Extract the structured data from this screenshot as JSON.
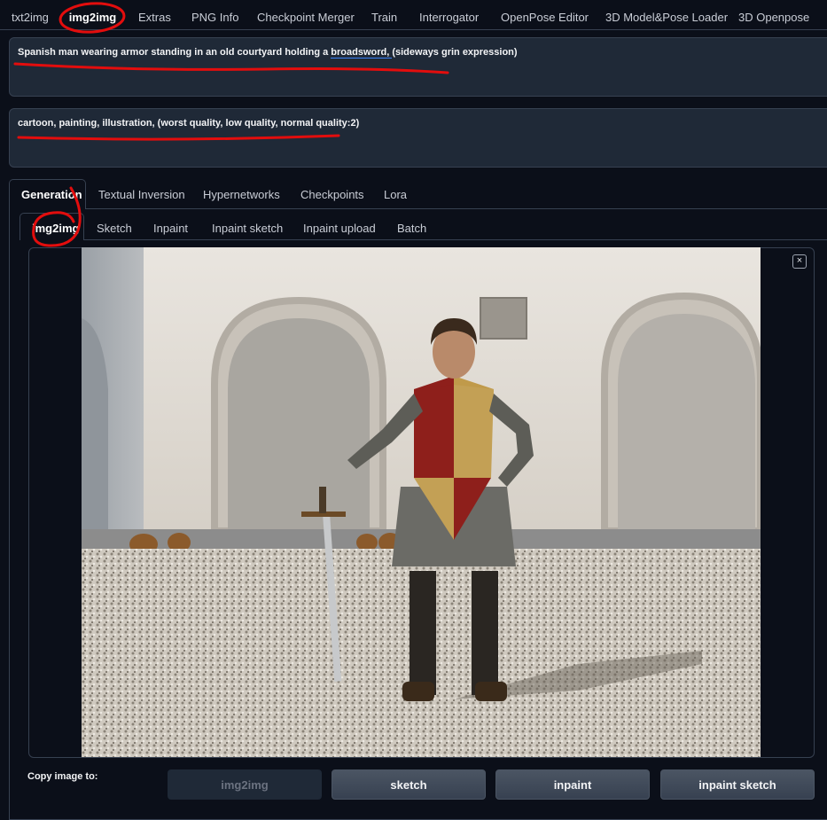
{
  "top_tabs": [
    {
      "label": "txt2img",
      "active": false
    },
    {
      "label": "img2img",
      "active": true
    },
    {
      "label": "Extras",
      "active": false
    },
    {
      "label": "PNG Info",
      "active": false
    },
    {
      "label": "Checkpoint Merger",
      "active": false
    },
    {
      "label": "Train",
      "active": false
    },
    {
      "label": "Interrogator",
      "active": false
    },
    {
      "label": "OpenPose Editor",
      "active": false
    },
    {
      "label": "3D Model&Pose Loader",
      "active": false
    },
    {
      "label": "3D Openpose",
      "active": false
    }
  ],
  "prompt": {
    "before": "Spanish man wearing armor standing in an old courtyard holding a ",
    "underlined": "broadsword, ",
    "after": " (sideways grin expression)"
  },
  "negative_prompt": "cartoon, painting, illustration, (worst quality, low quality, normal quality:2)",
  "sub_tabs": [
    {
      "label": "Generation",
      "active": true
    },
    {
      "label": "Textual Inversion",
      "active": false
    },
    {
      "label": "Hypernetworks",
      "active": false
    },
    {
      "label": "Checkpoints",
      "active": false
    },
    {
      "label": "Lora",
      "active": false
    }
  ],
  "mode_tabs": [
    {
      "label": "img2img",
      "active": true
    },
    {
      "label": "Sketch",
      "active": false
    },
    {
      "label": "Inpaint",
      "active": false
    },
    {
      "label": "Inpaint sketch",
      "active": false
    },
    {
      "label": "Inpaint upload",
      "active": false
    },
    {
      "label": "Batch",
      "active": false
    }
  ],
  "image_close": "×",
  "copy_label": "Copy image to:",
  "copy_buttons": [
    {
      "label": "img2img",
      "disabled": true
    },
    {
      "label": "sketch",
      "disabled": false
    },
    {
      "label": "inpaint",
      "disabled": false
    },
    {
      "label": "inpaint sketch",
      "disabled": false
    }
  ],
  "colors": {
    "annotation": "#e30d0d",
    "background": "#0b0f19",
    "panel": "#1f2937",
    "border": "#374151",
    "accent_underline": "#3b82f6"
  }
}
